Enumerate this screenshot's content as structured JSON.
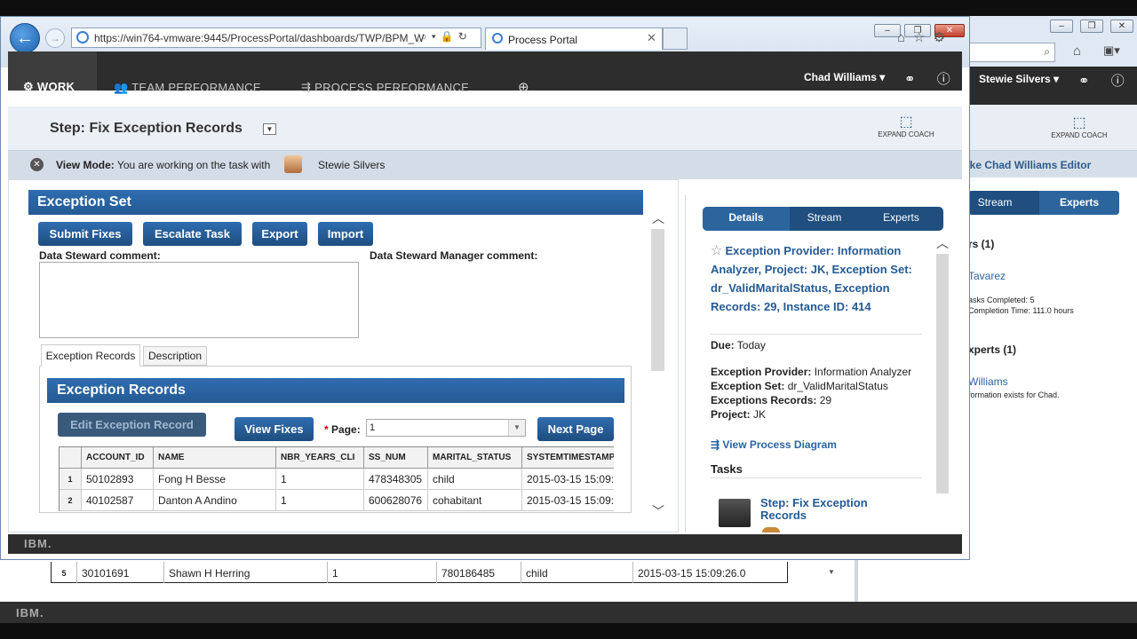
{
  "background_window": {
    "user": "Stewie Silvers",
    "expand_label": "EXPAND COACH",
    "banner": "ake Chad Williams Editor",
    "tabs": [
      "Stream",
      "Experts"
    ],
    "side_lines": [
      "rs (1)",
      "Tavarez",
      "asks Completed: 5",
      "Completion Time: 111.0 hours",
      "xperts (1)",
      "Williams",
      "formation exists for Chad."
    ],
    "row5": {
      "num": "5",
      "account_id": "30101691",
      "name": "Shawn H Herring",
      "nbr_years": "1",
      "ss_num": "780186485",
      "marital_status": "child",
      "systemtime": "2015-03-15 15:09:26.0"
    },
    "footer_logo": "IBM."
  },
  "browser": {
    "url": "https://win764-vmware:9445/ProcessPortal/dashboards/TWP/BPM_W",
    "tab_title": "Process Portal"
  },
  "nav": {
    "work": "WORK",
    "team_performance": "TEAM PERFORMANCE",
    "process_performance": "PROCESS PERFORMANCE",
    "add": "⊕",
    "user": "Chad Williams"
  },
  "step": {
    "title": "Step: Fix Exception Records",
    "expand_label": "EXPAND COACH"
  },
  "view_mode": {
    "label": "View Mode:",
    "text": "You are working on the task with",
    "user": "Stewie Silvers"
  },
  "exception_set": {
    "heading": "Exception Set",
    "buttons": [
      "Submit Fixes",
      "Escalate Task",
      "Export",
      "Import"
    ],
    "ds_comment_label": "Data Steward comment:",
    "dsm_comment_label": "Data Steward Manager comment:",
    "ds_comment_value": ""
  },
  "inner_tabs": [
    "Exception Records",
    "Description"
  ],
  "exception_records": {
    "heading": "Exception Records",
    "edit_button": "Edit Exception Record",
    "view_fixes_button": "View Fixes",
    "page_required": "*",
    "page_label": "Page:",
    "page_value": "1",
    "next_button": "Next Page",
    "columns": [
      "ACCOUNT_ID",
      "NAME",
      "NBR_YEARS_CLI",
      "SS_NUM",
      "MARITAL_STATUS",
      "SYSTEMTIMESTAMP"
    ],
    "rows": [
      {
        "num": "1",
        "account_id": "50102893",
        "name": "Fong H Besse",
        "nbr_years": "1",
        "ss_num": "478348305",
        "marital_status": "child",
        "systemtime": "2015-03-15 15:09:"
      },
      {
        "num": "2",
        "account_id": "40102587",
        "name": "Danton A Andino",
        "nbr_years": "1",
        "ss_num": "600628076",
        "marital_status": "cohabitant",
        "systemtime": "2015-03-15 15:09:"
      }
    ]
  },
  "details": {
    "tabs": [
      "Details",
      "Stream",
      "Experts"
    ],
    "title": "Exception Provider: Information Analyzer, Project: JK, Exception Set: dr_ValidMaritalStatus, Exception Records: 29, Instance ID: 414",
    "due_label": "Due:",
    "due_value": "Today",
    "provider_label": "Exception Provider:",
    "provider_value": "Information Analyzer",
    "set_label": "Exception Set:",
    "set_value": "dr_ValidMaritalStatus",
    "records_label": "Exceptions Records:",
    "records_value": "29",
    "project_label": "Project:",
    "project_value": "JK",
    "view_diagram": "View Process Diagram",
    "tasks_heading": "Tasks",
    "task_name": "Step: Fix Exception Records"
  },
  "footer_logo": "IBM.",
  "colors": {
    "nav_bg": "#2d2d2d",
    "accent": "#245a94",
    "button": "#1f4e7f"
  }
}
